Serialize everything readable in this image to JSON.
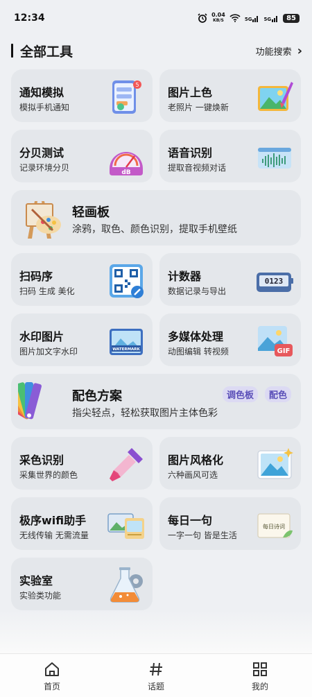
{
  "status_bar": {
    "time": "12:34",
    "network_speed_value": "0.04",
    "network_speed_unit": "KB/S",
    "signal_1": "5G",
    "signal_2": "5G",
    "battery": "85"
  },
  "header": {
    "title": "全部工具",
    "search_label": "功能搜索"
  },
  "tools": [
    {
      "title": "通知模拟",
      "subtitle": "模拟手机通知",
      "icon": "notification-phone-icon"
    },
    {
      "title": "图片上色",
      "subtitle": "老照片 一键焕新",
      "icon": "photo-brush-icon"
    },
    {
      "title": "分贝测试",
      "subtitle": "记录环境分贝",
      "icon": "decibel-meter-icon",
      "icon_text": "dB"
    },
    {
      "title": "语音识别",
      "subtitle": "提取音视频对话",
      "icon": "audio-wave-icon"
    },
    {
      "title": "轻画板",
      "subtitle": "涂鸦，取色、颜色识别，提取手机壁纸",
      "icon": "easel-palette-icon"
    },
    {
      "title": "扫码序",
      "subtitle": "扫码 生成 美化",
      "icon": "qr-code-icon"
    },
    {
      "title": "计数器",
      "subtitle": "数据记录与导出",
      "icon": "counter-icon",
      "icon_text": "0123"
    },
    {
      "title": "水印图片",
      "subtitle": "图片加文字水印",
      "icon": "watermark-icon",
      "icon_text": "WATERMARK"
    },
    {
      "title": "多媒体处理",
      "subtitle": "动图编辑 转视频",
      "icon": "gif-icon",
      "icon_text": "GIF"
    },
    {
      "title": "配色方案",
      "subtitle": "指尖轻点，轻松获取图片主体色彩",
      "icon": "color-swatch-icon",
      "tags": [
        "调色板",
        "配色"
      ]
    },
    {
      "title": "采色识别",
      "subtitle": "采集世界的颜色",
      "icon": "eyedropper-icon"
    },
    {
      "title": "图片风格化",
      "subtitle": "六种画风可选",
      "icon": "landscape-picture-icon"
    },
    {
      "title": "极序wifi助手",
      "subtitle": "无线传输 无需流量",
      "icon": "wifi-transfer-icon"
    },
    {
      "title": "每日一句",
      "subtitle": "一字一句 皆是生活",
      "icon": "daily-quote-card-icon",
      "icon_text": "每日诗词"
    },
    {
      "title": "实验室",
      "subtitle": "实验类功能",
      "icon": "flask-gear-icon"
    }
  ],
  "bottom_nav": [
    {
      "label": "首页",
      "icon": "home-icon"
    },
    {
      "label": "话题",
      "icon": "hashtag-icon"
    },
    {
      "label": "我的",
      "icon": "grid-icon"
    }
  ]
}
